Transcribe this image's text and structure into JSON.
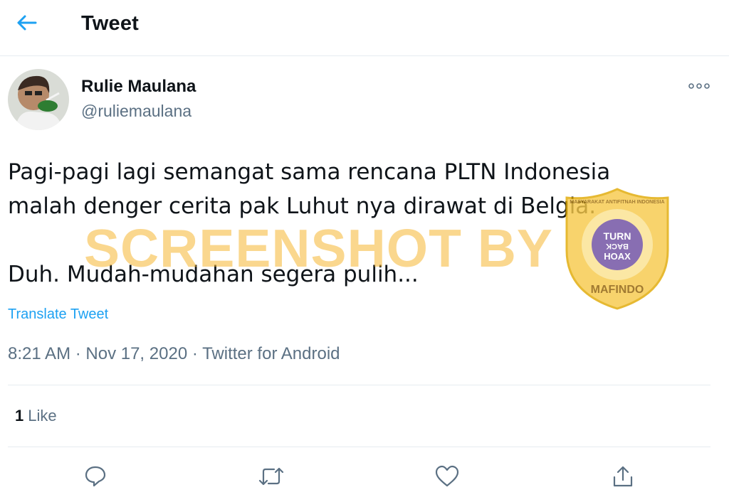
{
  "header": {
    "title": "Tweet",
    "back_icon": "arrow-left-icon"
  },
  "author": {
    "name": "Rulie Maulana",
    "handle": "@ruliemaulana"
  },
  "tweet": {
    "lines": [
      "Pagi-pagi lagi semangat sama rencana PLTN Indonesia",
      "malah denger cerita pak Luhut nya dirawat di Belgia.",
      "Duh. Mudah-mudahan segera pulih..."
    ],
    "translate_label": "Translate Tweet"
  },
  "meta": {
    "time": "8:21 AM",
    "separator": " · ",
    "date": "Nov 17, 2020",
    "source": "Twitter for Android"
  },
  "stats": {
    "likes_count": "1",
    "likes_label": "Like"
  },
  "actions": [
    "reply-icon",
    "retweet-icon",
    "like-icon",
    "share-icon"
  ],
  "watermark": {
    "text": "SCREENSHOT BY",
    "badge_top": "MASYARAKAT ANTIFITNAH INDONESIA",
    "badge_center": [
      "TURN",
      "BACK",
      "HOAX"
    ],
    "badge_bottom": "MAFINDO"
  },
  "colors": {
    "accent": "#1da1f2",
    "secondary_text": "#5b7083",
    "divider": "#e6ecf0",
    "watermark": "#f7b733"
  }
}
